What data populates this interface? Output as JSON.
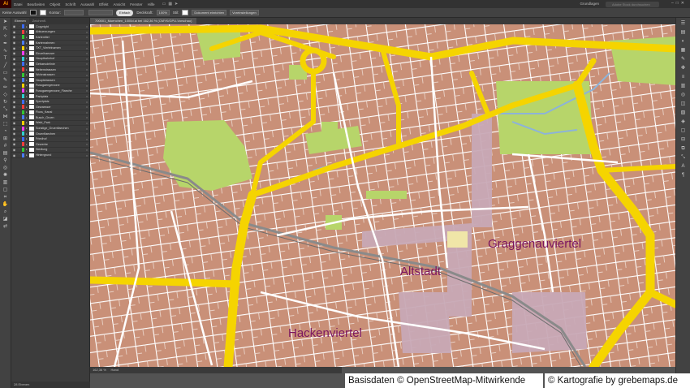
{
  "app": {
    "logo": "Ai",
    "menus": [
      "Datei",
      "Bearbeiten",
      "Objekt",
      "Schrift",
      "Auswahl",
      "Effekt",
      "Ansicht",
      "Fenster",
      "Hilfe"
    ],
    "workspace": "Grundlagen",
    "search_placeholder": "Adobe Stock durchsuchen"
  },
  "control_bar": {
    "selection": "Keine Auswahl",
    "stroke_label": "Kontur:",
    "brush": "Einfach",
    "opacity_label": "Deckkraft:",
    "opacity_value": "100%",
    "style_label": "Stil:",
    "doc_setup": "Dokument einrichten",
    "preferences": "Voreinstellungen"
  },
  "document": {
    "tab_title": "700001_Muenchen_1000d.ai bei 162,36 % (CMYK/GPU-Vorschau)",
    "zoom": "162,36 %",
    "status": "Hand"
  },
  "layers_panel": {
    "tabs": [
      "Ebenen",
      "Zeichenfl."
    ],
    "footer": "28 Ebenen",
    "layers": [
      {
        "name": "Copyright",
        "color": "#3c6cff"
      },
      {
        "name": "Abkuerzungen",
        "color": "#ff3d3d"
      },
      {
        "name": "Kartentitel",
        "color": "#34c634"
      },
      {
        "name": "Kartenrahmen",
        "color": "#4a7dff"
      },
      {
        "name": "TXT_Viertelnamen",
        "color": "#ffd200"
      },
      {
        "name": "Einzelhaeuser",
        "color": "#ff3dff"
      },
      {
        "name": "Hauptbahnhof",
        "color": "#2fd0d0"
      },
      {
        "name": "Gebaeudelinie",
        "color": "#3c6cff"
      },
      {
        "name": "Nebenstrassen",
        "color": "#ff3d3d"
      },
      {
        "name": "Wohnstrassen",
        "color": "#34c634"
      },
      {
        "name": "Hauptstrassen",
        "color": "#4a7dff"
      },
      {
        "name": "Fussgaengerzone",
        "color": "#ffd200"
      },
      {
        "name": "Fussgaengerzone_Flaeche",
        "color": "#ff3dff"
      },
      {
        "name": "Parkplatz",
        "color": "#2fd0d0"
      },
      {
        "name": "Sportplatz",
        "color": "#3c6cff"
      },
      {
        "name": "Gewaesser",
        "color": "#ff3d3d"
      },
      {
        "name": "Fluss_Kanal",
        "color": "#34c634"
      },
      {
        "name": "Busch_Gruen",
        "color": "#4a7dff"
      },
      {
        "name": "Wald_Park",
        "color": "#ffd200"
      },
      {
        "name": "Sonstige_Gruenflaechen",
        "color": "#ff3dff"
      },
      {
        "name": "Gruenflaechen",
        "color": "#2fd0d0"
      },
      {
        "name": "Friedhof",
        "color": "#3c6cff"
      },
      {
        "name": "Gewerbe",
        "color": "#ff3d3d"
      },
      {
        "name": "Siedlung",
        "color": "#34c634"
      },
      {
        "name": "Hintergrund",
        "color": "#4a7dff"
      }
    ]
  },
  "map": {
    "districts": [
      "Graggenauviertel",
      "Altstadt",
      "Hackenviertel"
    ]
  },
  "credits": {
    "left": "Basisdaten © OpenStreetMap-Mitwirkende",
    "right": "© Kartografie by grebemaps.de"
  },
  "colors": {
    "buildings": "#c99078",
    "roads_major": "#f5d400",
    "roads_minor": "#ffffff",
    "parks": "#b7d56a",
    "pedestrian": "#c8a9b6",
    "district_labels": "#7b1560"
  }
}
